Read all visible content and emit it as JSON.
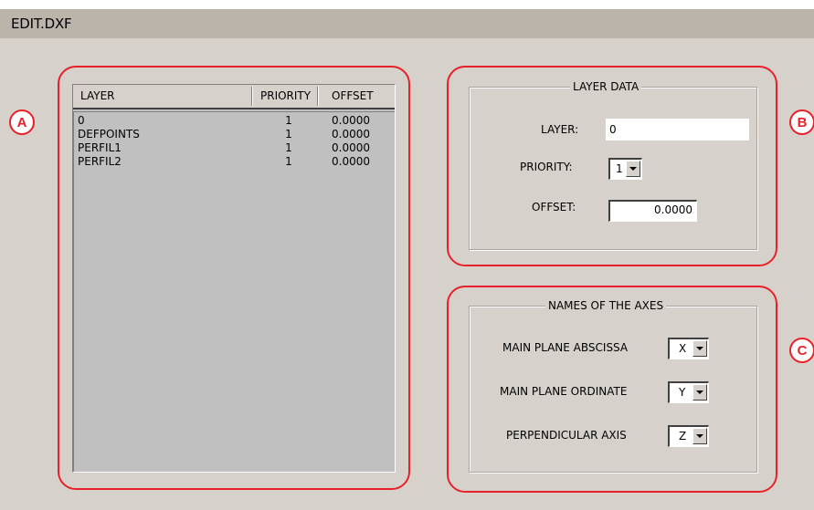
{
  "window": {
    "title": "EDIT.DXF"
  },
  "badges": {
    "a": "A",
    "b": "B",
    "c": "C"
  },
  "layer_list": {
    "headers": {
      "layer": "LAYER",
      "priority": "PRIORITY",
      "offset": "OFFSET"
    },
    "rows": [
      {
        "layer": "0",
        "priority": "1",
        "offset": "0.0000"
      },
      {
        "layer": "DEFPOINTS",
        "priority": "1",
        "offset": "0.0000"
      },
      {
        "layer": "PERFIL1",
        "priority": "1",
        "offset": "0.0000"
      },
      {
        "layer": "PERFIL2",
        "priority": "1",
        "offset": "0.0000"
      }
    ]
  },
  "layer_data": {
    "title": "LAYER DATA",
    "layer_label": "LAYER:",
    "layer_value": "0",
    "priority_label": "PRIORITY:",
    "priority_value": "1",
    "offset_label": "OFFSET:",
    "offset_value": "0.0000"
  },
  "axes": {
    "title": "NAMES OF THE AXES",
    "abscissa_label": "MAIN PLANE ABSCISSA",
    "abscissa_value": "X",
    "ordinate_label": "MAIN PLANE ORDINATE",
    "ordinate_value": "Y",
    "perpendicular_label": "PERPENDICULAR AXIS",
    "perpendicular_value": "Z"
  },
  "colors": {
    "annotation": "#e8202a",
    "window_bg": "#d6d2cb",
    "titlebar": "#bab4ab",
    "list_bg": "#c0c0c0"
  }
}
